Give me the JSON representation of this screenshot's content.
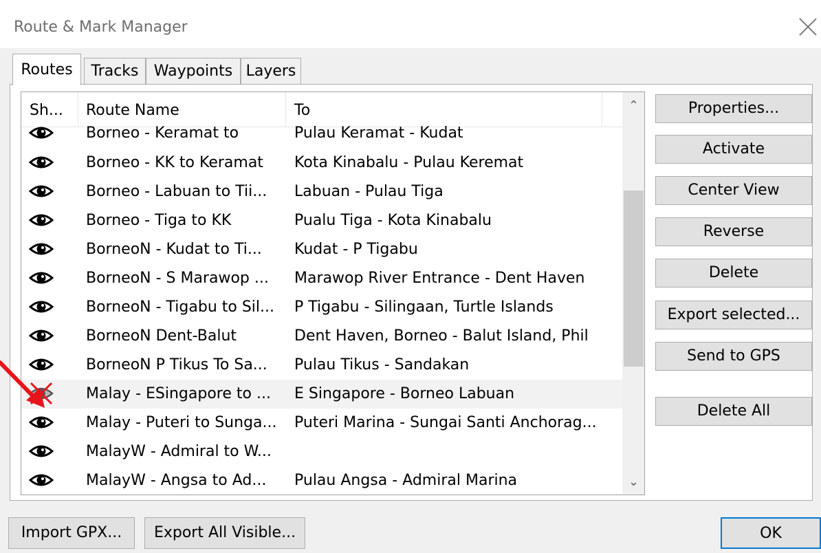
{
  "window": {
    "title": "Route & Mark Manager"
  },
  "tabs": [
    "Routes",
    "Tracks",
    "Waypoints",
    "Layers"
  ],
  "list": {
    "headers": {
      "show": "Sh...",
      "name": "Route Name",
      "to": "To"
    },
    "rows": [
      {
        "name": "Borneo - Keramat to",
        "to": "Pulau Keramat - Kudat",
        "visible": true
      },
      {
        "name": "Borneo - KK to Keramat",
        "to": "Kota Kinabalu - Pulau Keremat",
        "visible": true
      },
      {
        "name": "Borneo - Labuan to Tii...",
        "to": "Labuan - Pulau Tiga",
        "visible": true
      },
      {
        "name": "Borneo - Tiga to KK",
        "to": "Pualu Tiga - Kota Kinabalu",
        "visible": true
      },
      {
        "name": "BorneoN - Kudat to Ti...",
        "to": "Kudat - P Tigabu",
        "visible": true
      },
      {
        "name": "BorneoN - S Marawop ...",
        "to": "Marawop River Entrance - Dent Haven",
        "visible": true
      },
      {
        "name": "BorneoN - Tigabu to Sil...",
        "to": "P Tigabu - Silingaan, Turtle Islands",
        "visible": true
      },
      {
        "name": "BorneoN Dent-Balut",
        "to": "Dent Haven, Borneo - Balut Island, Phil",
        "visible": true
      },
      {
        "name": "BorneoN P Tikus To Sa...",
        "to": "Pulau Tikus - Sandakan",
        "visible": true
      },
      {
        "name": "Malay - ESingapore to ...",
        "to": "E Singapore - Borneo Labuan",
        "visible": false
      },
      {
        "name": "Malay - Puteri to Sunga...",
        "to": "Puteri Marina - Sungai Santi Anchorag...",
        "visible": true
      },
      {
        "name": "MalayW - Admiral to W...",
        "to": "",
        "visible": true
      },
      {
        "name": "MalayW - Angsa to Ad...",
        "to": "Pulau Angsa - Admiral Marina",
        "visible": true
      }
    ]
  },
  "side_buttons": [
    "Properties...",
    "Activate",
    "Center View",
    "Reverse",
    "Delete",
    "Export selected...",
    "Send to GPS",
    "Delete All"
  ],
  "bottom_buttons": {
    "import": "Import GPX...",
    "export": "Export All Visible...",
    "ok": "OK"
  },
  "icons": {
    "close": "close-icon",
    "eye": "eye-icon",
    "hidden": "eye-crossed-icon",
    "annotation": "red-arrow-annotation"
  },
  "colors": {
    "accent": "#0078d7",
    "annotation": "#e8141b"
  }
}
